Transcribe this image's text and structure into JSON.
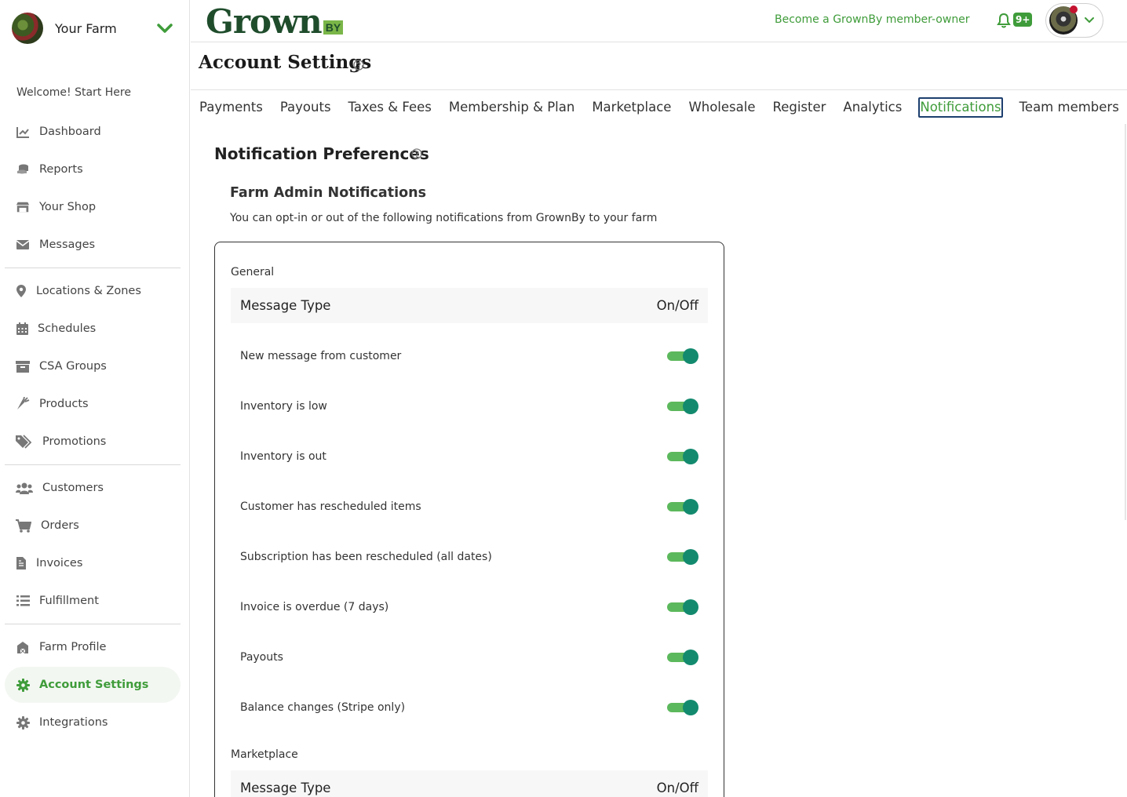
{
  "sidebar": {
    "farm_name": "Your Farm",
    "welcome": "Welcome! Start Here",
    "items": [
      {
        "label": "Dashboard",
        "icon": "chart-line-icon"
      },
      {
        "label": "Reports",
        "icon": "coins-icon"
      },
      {
        "label": "Your Shop",
        "icon": "store-icon"
      },
      {
        "label": "Messages",
        "icon": "envelope-icon"
      },
      {
        "label": "Locations & Zones",
        "icon": "map-pin-icon"
      },
      {
        "label": "Schedules",
        "icon": "calendar-icon"
      },
      {
        "label": "CSA Groups",
        "icon": "box-icon"
      },
      {
        "label": "Products",
        "icon": "carrot-icon"
      },
      {
        "label": "Promotions",
        "icon": "tags-icon"
      },
      {
        "label": "Customers",
        "icon": "users-icon"
      },
      {
        "label": "Orders",
        "icon": "cart-icon"
      },
      {
        "label": "Invoices",
        "icon": "invoice-icon"
      },
      {
        "label": "Fulfillment",
        "icon": "list-icon"
      },
      {
        "label": "Farm Profile",
        "icon": "barn-icon"
      },
      {
        "label": "Account Settings",
        "icon": "gear-icon",
        "active": true
      },
      {
        "label": "Integrations",
        "icon": "gear-icon"
      }
    ]
  },
  "header": {
    "logo_text": "Grown",
    "logo_badge": "BY",
    "member_link": "Become a GrownBy member-owner",
    "notification_badge": "9+"
  },
  "page": {
    "title": "Account Settings",
    "tabs": [
      {
        "label": "Payments"
      },
      {
        "label": "Payouts"
      },
      {
        "label": "Taxes & Fees"
      },
      {
        "label": "Membership & Plan"
      },
      {
        "label": "Marketplace"
      },
      {
        "label": "Wholesale"
      },
      {
        "label": "Register"
      },
      {
        "label": "Analytics"
      },
      {
        "label": "Notifications",
        "active": true
      },
      {
        "label": "Team members"
      }
    ]
  },
  "content": {
    "section_title": "Notification Preferences",
    "sub_title": "Farm Admin Notifications",
    "sub_desc": "You can opt-in or out of the following notifications from GrownBy to your farm",
    "groups": [
      {
        "label": "General",
        "col_type": "Message Type",
        "col_toggle": "On/Off",
        "rows": [
          {
            "label": "New message from customer",
            "on": true
          },
          {
            "label": "Inventory is low",
            "on": true
          },
          {
            "label": "Inventory is out",
            "on": true
          },
          {
            "label": "Customer has rescheduled items",
            "on": true
          },
          {
            "label": "Subscription has been rescheduled (all dates)",
            "on": true
          },
          {
            "label": "Invoice is overdue (7 days)",
            "on": true
          },
          {
            "label": "Payouts",
            "on": true
          },
          {
            "label": "Balance changes (Stripe only)",
            "on": true
          }
        ]
      },
      {
        "label": "Marketplace",
        "col_type": "Message Type",
        "col_toggle": "On/Off",
        "rows": []
      }
    ]
  },
  "colors": {
    "accent": "#3f9c3a",
    "toggle_track": "#5cb85c",
    "toggle_knob": "#138a6e",
    "logo_dark": "#1f4d2c"
  }
}
